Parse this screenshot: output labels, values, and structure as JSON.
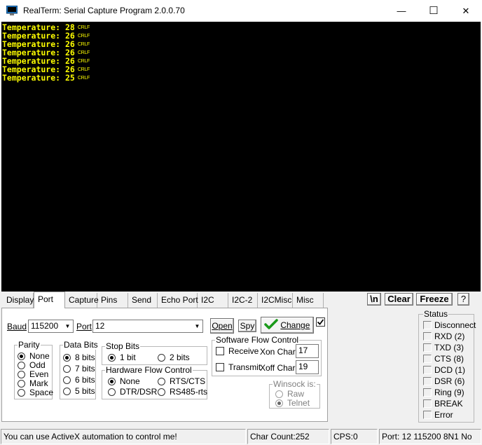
{
  "window": {
    "title": "RealTerm: Serial Capture Program 2.0.0.70",
    "minimize_glyph": "—",
    "maximize_glyph": "☐",
    "close_glyph": "✕"
  },
  "terminal": {
    "lines": [
      {
        "text": "Temperature: 28",
        "eol": "CRLF"
      },
      {
        "text": "Temperature: 26",
        "eol": "CRLF"
      },
      {
        "text": "Temperature: 26",
        "eol": "CRLF"
      },
      {
        "text": "Temperature: 26",
        "eol": "CRLF"
      },
      {
        "text": "Temperature: 26",
        "eol": "CRLF"
      },
      {
        "text": "Temperature: 26",
        "eol": "CRLF"
      },
      {
        "text": "Temperature: 25",
        "eol": "CRLF"
      }
    ],
    "background": "#000000",
    "text_color": "#ffff00"
  },
  "tabs": [
    {
      "label": "Display",
      "active": false
    },
    {
      "label": "Port",
      "active": true
    },
    {
      "label": "Capture",
      "active": false
    },
    {
      "label": "Pins",
      "active": false
    },
    {
      "label": "Send",
      "active": false
    },
    {
      "label": "Echo Port",
      "active": false
    },
    {
      "label": "I2C",
      "active": false
    },
    {
      "label": "I2C-2",
      "active": false
    },
    {
      "label": "I2CMisc",
      "active": false
    },
    {
      "label": "Misc",
      "active": false
    }
  ],
  "toolbar": {
    "newline_label": "\\n",
    "clear_label": "Clear",
    "freeze_label": "Freeze",
    "help_label": "?"
  },
  "port": {
    "baud_label": "Baud",
    "baud_value": "115200",
    "port_label": "Port",
    "port_value": "12",
    "open_label": "Open",
    "spy_label": "Spy",
    "change_label": "Change",
    "change_check_checked": true
  },
  "parity": {
    "title": "Parity",
    "options": [
      "None",
      "Odd",
      "Even",
      "Mark",
      "Space"
    ],
    "selected": "None"
  },
  "data_bits": {
    "title": "Data Bits",
    "options": [
      "8 bits",
      "7 bits",
      "6 bits",
      "5 bits"
    ],
    "selected": "8 bits"
  },
  "stop_bits": {
    "title": "Stop Bits",
    "options": [
      "1 bit",
      "2 bits"
    ],
    "selected": "1 bit"
  },
  "hw_flow": {
    "title": "Hardware Flow Control",
    "options": [
      "None",
      "RTS/CTS",
      "DTR/DSR",
      "RS485-rts"
    ],
    "selected": "None"
  },
  "sw_flow": {
    "title": "Software Flow Control",
    "receive_label": "Receive",
    "transmit_label": "Transmit",
    "xon_label": "Xon Char:",
    "xon_value": "17",
    "xoff_label": "Xoff Char:",
    "xoff_value": "19"
  },
  "winsock": {
    "title": "Winsock is:",
    "options": [
      "Raw",
      "Telnet"
    ],
    "selected": "Telnet"
  },
  "status": {
    "title": "Status",
    "items": [
      "Disconnect",
      "RXD (2)",
      "TXD (3)",
      "CTS (8)",
      "DCD (1)",
      "DSR (6)",
      "Ring (9)",
      "BREAK",
      "Error"
    ]
  },
  "statusbar": {
    "message": "You can use ActiveX automation to control me!",
    "char_count": "Char Count:252",
    "cps": "CPS:0",
    "port_info": "Port: 12 115200 8N1 No"
  }
}
